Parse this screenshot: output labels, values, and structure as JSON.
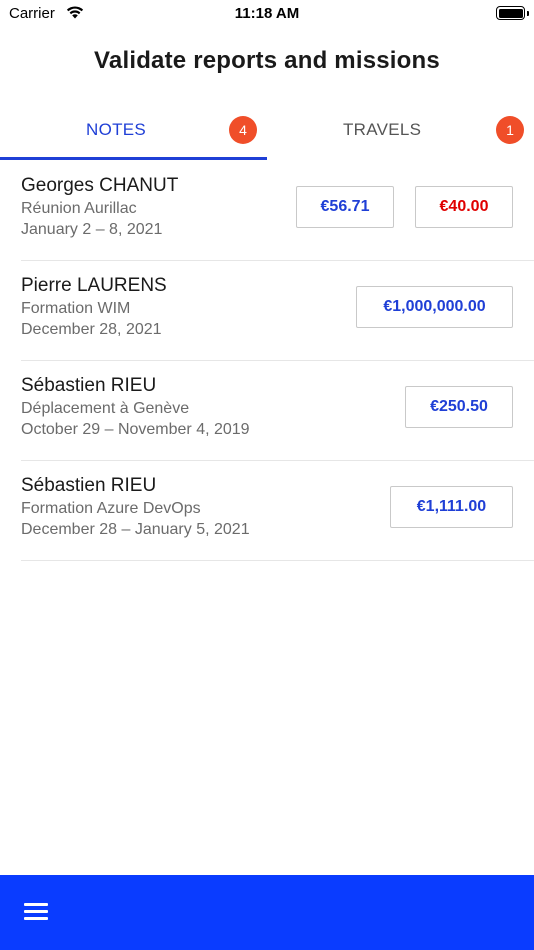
{
  "status_bar": {
    "carrier": "Carrier",
    "time": "11:18 AM"
  },
  "header": {
    "title": "Validate reports and missions"
  },
  "tabs": [
    {
      "label": "NOTES",
      "badge": "4",
      "active": true
    },
    {
      "label": "TRAVELS",
      "badge": "1",
      "active": false
    }
  ],
  "reports": [
    {
      "name": "Georges CHANUT",
      "mission": "Réunion Aurillac",
      "dates": "January 2 – 8, 2021",
      "amounts": [
        "€56.71",
        "€40.00"
      ]
    },
    {
      "name": "Pierre LAURENS",
      "mission": "Formation WIM",
      "dates": "December 28, 2021",
      "amounts": [
        "€1,000,000.00"
      ]
    },
    {
      "name": "Sébastien RIEU",
      "mission": "Déplacement à Genève",
      "dates": "October 29 – November 4, 2019",
      "amounts": [
        "€250.50"
      ]
    },
    {
      "name": "Sébastien RIEU",
      "mission": "Formation Azure DevOps",
      "dates": "December 28 – January 5, 2021",
      "amounts": [
        "€1,111.00"
      ]
    }
  ],
  "colors": {
    "accent": "#1f3fd6",
    "badge": "#f04e29",
    "bottom_bar": "#0a3cff",
    "negative_amount": "#e00000"
  },
  "bottom_bar": {
    "menu_icon": "hamburger-menu-icon"
  }
}
